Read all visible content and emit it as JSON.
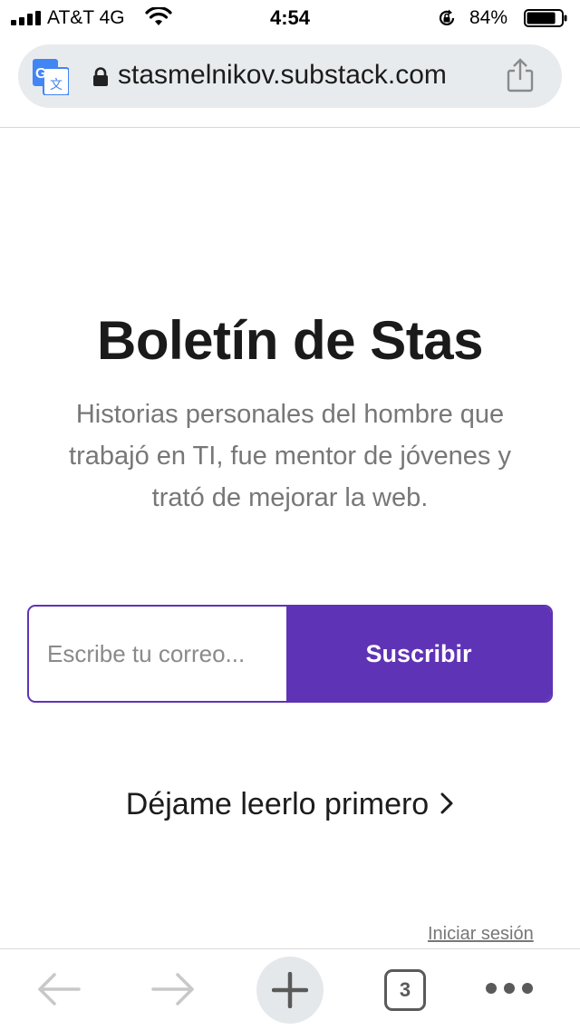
{
  "status_bar": {
    "carrier": "AT&T 4G",
    "time": "4:54",
    "battery_percent": "84%",
    "battery_level": 0.84,
    "icons": [
      "signal-icon",
      "wifi-icon",
      "rotation-lock-icon",
      "battery-icon"
    ]
  },
  "browser": {
    "url": "stasmelnikov.substack.com",
    "icons": [
      "translate-icon",
      "lock-icon",
      "share-icon"
    ]
  },
  "main": {
    "title": "Boletín de Stas",
    "description": "Historias personales del hombre que trabajó en TI, fue mentor de jóvenes y trató de mejorar la web.",
    "email_placeholder": "Escribe tu correo...",
    "subscribe_label": "Suscribir",
    "read_first_label": "Déjame leerlo primero",
    "login_label": "Iniciar sesión"
  },
  "toolbar": {
    "tab_count": "3",
    "icons": [
      "back-icon",
      "forward-icon",
      "new-tab-icon",
      "tabs-icon",
      "more-icon"
    ]
  },
  "colors": {
    "accent": "#5f33b5",
    "url_bar_bg": "#e8ebee",
    "subtitle": "#777777"
  }
}
